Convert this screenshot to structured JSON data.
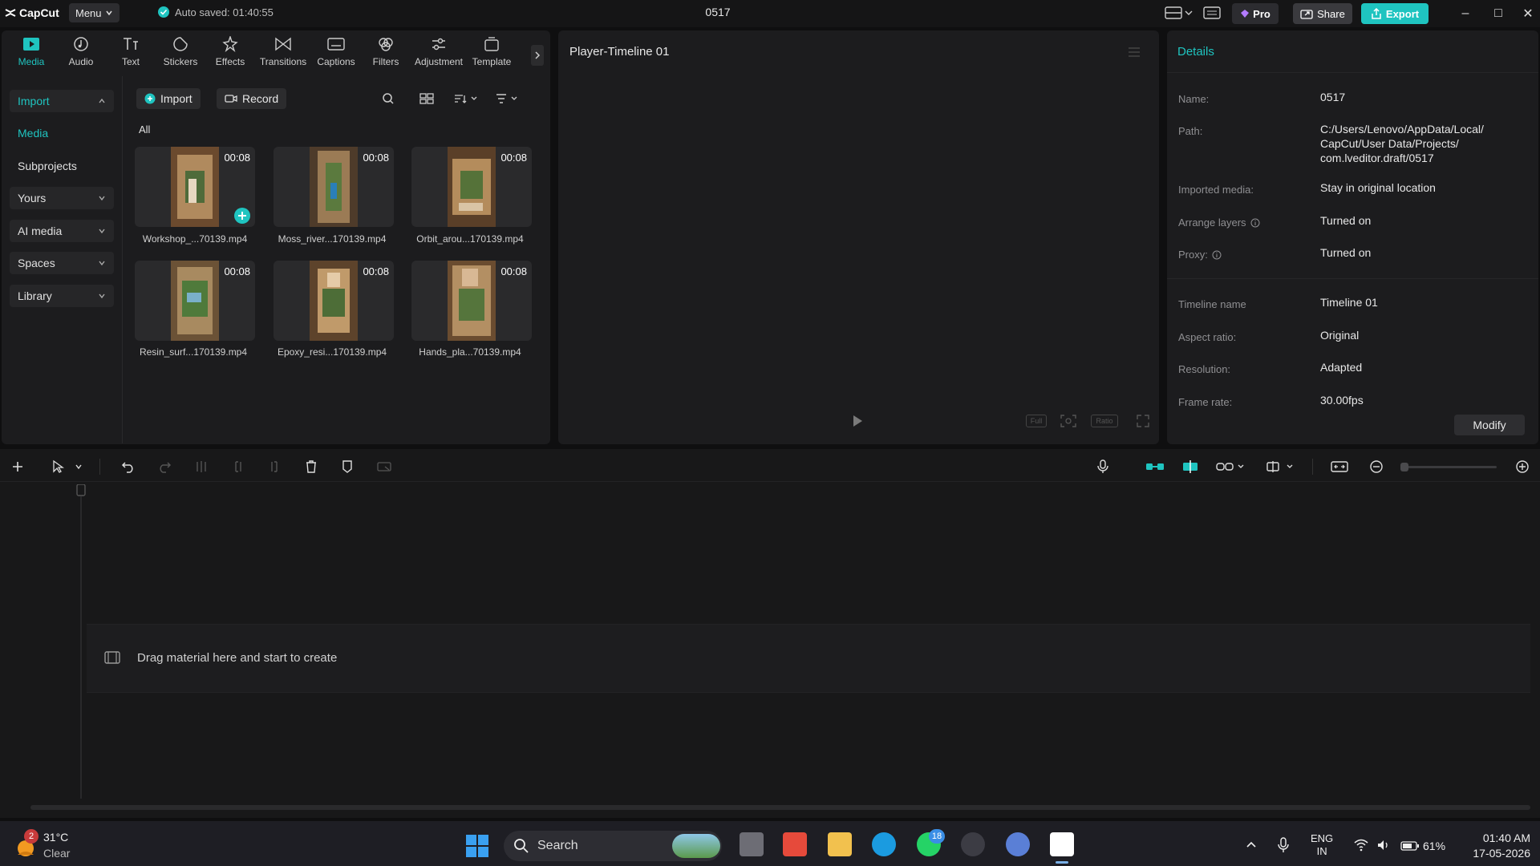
{
  "app": {
    "name": "CapCut",
    "menu_label": "Menu",
    "autosave": "Auto saved: 01:40:55",
    "project_title": "0517",
    "pro_label": "Pro",
    "share_label": "Share",
    "export_label": "Export"
  },
  "toolbar": {
    "tabs": [
      {
        "label": "Media",
        "icon": "media-icon"
      },
      {
        "label": "Audio",
        "icon": "audio-icon"
      },
      {
        "label": "Text",
        "icon": "text-icon"
      },
      {
        "label": "Stickers",
        "icon": "stickers-icon"
      },
      {
        "label": "Effects",
        "icon": "effects-icon"
      },
      {
        "label": "Transitions",
        "icon": "transitions-icon"
      },
      {
        "label": "Captions",
        "icon": "captions-icon"
      },
      {
        "label": "Filters",
        "icon": "filters-icon"
      },
      {
        "label": "Adjustment",
        "icon": "adjustment-icon"
      },
      {
        "label": "Template",
        "icon": "template-icon"
      }
    ]
  },
  "sidebar": {
    "items": [
      {
        "label": "Import"
      },
      {
        "label": "Media"
      },
      {
        "label": "Subprojects"
      },
      {
        "label": "Yours"
      },
      {
        "label": "AI media"
      },
      {
        "label": "Spaces"
      },
      {
        "label": "Library"
      }
    ]
  },
  "media": {
    "import_label": "Import",
    "record_label": "Record",
    "filter_all": "All",
    "clips": [
      {
        "name": "Workshop_...70139.mp4",
        "duration": "00:08"
      },
      {
        "name": "Moss_river...170139.mp4",
        "duration": "00:08"
      },
      {
        "name": "Orbit_arou...170139.mp4",
        "duration": "00:08"
      },
      {
        "name": "Resin_surf...170139.mp4",
        "duration": "00:08"
      },
      {
        "name": "Epoxy_resi...170139.mp4",
        "duration": "00:08"
      },
      {
        "name": "Hands_pla...70139.mp4",
        "duration": "00:08"
      }
    ]
  },
  "player": {
    "title": "Player-Timeline 01",
    "btn_full": "Full",
    "btn_ratio": "Ratio"
  },
  "details": {
    "title": "Details",
    "rows": [
      {
        "label": "Name:",
        "value": "0517"
      },
      {
        "label": "Path:",
        "value": "C:/Users/Lenovo/AppData/Local/ CapCut/User Data/Projects/ com.lveditor.draft/0517"
      },
      {
        "label": "Imported media:",
        "value": "Stay in original location"
      },
      {
        "label": "Arrange layers",
        "value": "Turned on"
      },
      {
        "label": "Proxy:",
        "value": "Turned on"
      },
      {
        "label": "Timeline name",
        "value": "Timeline 01"
      },
      {
        "label": "Aspect ratio:",
        "value": "Original"
      },
      {
        "label": "Resolution:",
        "value": "Adapted"
      },
      {
        "label": "Frame rate:",
        "value": "30.00fps"
      }
    ],
    "modify_label": "Modify"
  },
  "timeline": {
    "drop_hint": "Drag material here and start to create"
  },
  "taskbar": {
    "weather_temp": "31°C",
    "weather_desc": "Clear",
    "weather_badge": "2",
    "search_label": "Search",
    "whatsapp_badge": "18",
    "lang_line1": "ENG",
    "lang_line2": "IN",
    "battery": "61%",
    "time": "01:40 AM",
    "date": "17-05-2026"
  },
  "colors": {
    "accent": "#1fc4c0",
    "panel": "#1c1c1e",
    "background": "#0f0f10"
  }
}
